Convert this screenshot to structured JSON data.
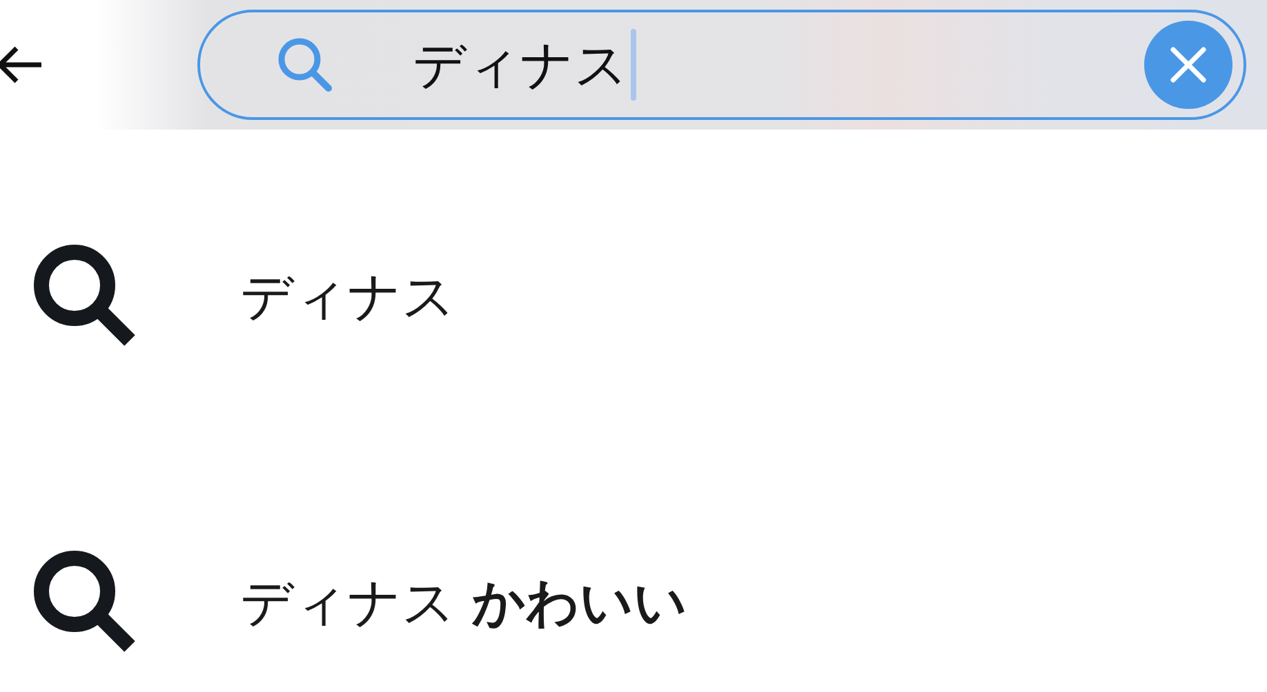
{
  "search": {
    "value": "ディナス"
  },
  "suggestions": [
    {
      "text": "ディナス"
    },
    {
      "text": "ディナス **かわいい**"
    }
  ]
}
